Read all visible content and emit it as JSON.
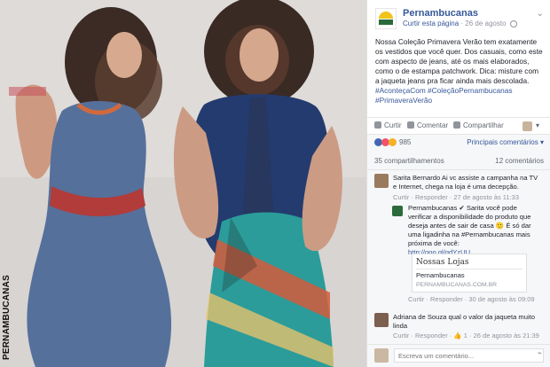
{
  "photo": {
    "side_brand": "PERNAMBUCANAS"
  },
  "post": {
    "page_name": "Pernambucanas",
    "like_page": "Curtir esta página",
    "date": "26 de agosto",
    "text_lines": [
      "Nossa Coleção Primavera Verão tem exatamente",
      "os vestidos que você quer. Dos casuais, como este",
      "com aspecto de jeans, até os mais elaborados,",
      "como o de estampa patchwork. Dica: misture com",
      "a jaqueta jeans pra ficar ainda mais descolada."
    ],
    "hashtags_line1": "#AconteçaCom #ColeçãoPernambucanas",
    "hashtags_line2": "#PrimaveraVerão"
  },
  "actions": {
    "like": "Curtir",
    "comment": "Comentar",
    "share": "Compartilhar"
  },
  "reactions": {
    "count": "985",
    "top_comments": "Principais comentários ▾"
  },
  "counts": {
    "shares": "35 compartilhamentos",
    "comments": "12 comentários"
  },
  "comments": [
    {
      "author": "Sarita Bernardo",
      "lines": [
        "Sarita Bernardo Ai vc assiste a campanha na TV",
        "e Internet, chega na loja é uma decepção."
      ],
      "actions": "Curtir · Responder · 27 de agosto às 11:33"
    },
    {
      "author": "Pernambucanas",
      "lines": [
        "Pernambucanas ✔ Sarita você pode",
        "verificar a disponibilidade do produto que",
        "deseja antes de sair de casa 🙂 É só dar",
        "uma ligadinha na #Pernambucanas mais",
        "próxima de você:",
        "http://goo.gl/gdYzUU"
      ],
      "actions": "Curtir · Responder · 30 de agosto às 09:09"
    },
    {
      "author": "Adriana de Souza",
      "lines": [
        "Adriana de Souza qual o valor da jaqueta muito",
        "linda"
      ],
      "actions": "Curtir · Responder · 👍 1 · 26 de agosto às 21:39"
    }
  ],
  "link_card": {
    "title": "Nossas Lojas",
    "subtitle": "Pernambucanas",
    "domain": "PERNAMBUCANAS.COM.BR"
  },
  "write": {
    "placeholder": "Escreva um comentário..."
  }
}
